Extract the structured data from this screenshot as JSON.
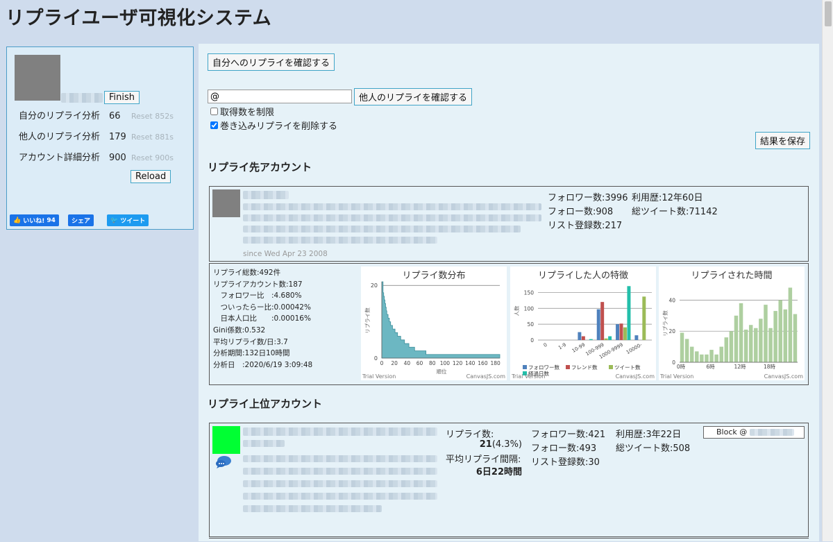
{
  "page": {
    "title": "リプライユーザ可視化システム"
  },
  "sidebar": {
    "finish_label": "Finish",
    "stats": [
      {
        "label": "自分のリプライ分析",
        "value": "66",
        "reset": "Reset 852s"
      },
      {
        "label": "他人のリプライ分析",
        "value": "179",
        "reset": "Reset 881s"
      },
      {
        "label": "アカウント詳細分析",
        "value": "900",
        "reset": "Reset 900s"
      }
    ],
    "reload_label": "Reload",
    "social": {
      "like_label": "いいね!",
      "like_count": "94",
      "share_label": "シェア",
      "tweet_label": "ツイート"
    }
  },
  "controls": {
    "check_own_button": "自分へのリプライを確認する",
    "at_input_value": "@",
    "check_others_button": "他人のリプライを確認する",
    "limit_checkbox_label": "取得数を制限",
    "limit_checked": false,
    "remove_checkbox_label": "巻き込みリプライを削除する",
    "remove_checked": true,
    "save_button": "結果を保存"
  },
  "reply_target": {
    "heading": "リプライ先アカウント",
    "since": "since Wed Apr 23 2008",
    "followers": "フォロワー数:3996",
    "tenure": "利用歴:12年60日",
    "following": "フォロー数:908",
    "total_tweets": "総ツイート数:71142",
    "listed": "リスト登録数:217"
  },
  "summary": {
    "lines": [
      "リプライ総数:492件",
      "リプライアカウント数:187",
      "　フォロワー比　:4.680%",
      "　ついったらー比:0.00042%",
      "　日本人口比　　:0.00016%",
      "Gini係数:0.532",
      "平均リプライ数/日:3.7",
      "分析期間:132日10時間",
      "分析日　:2020/6/19 3:09:48"
    ]
  },
  "charts": {
    "trial_label": "Trial Version",
    "brand_label": "CanvasJS.com"
  },
  "chart_data": [
    {
      "type": "area",
      "title": "リプライ数分布",
      "xlabel": "順位",
      "ylabel": "リプライ数",
      "xlim": [
        0,
        187
      ],
      "ylim": [
        0,
        21
      ],
      "x_ticks": [
        "0",
        "20",
        "40",
        "60",
        "80",
        "100",
        "120",
        "140",
        "160",
        "180"
      ],
      "y_ticks": [
        "0",
        "20"
      ],
      "values": [
        21,
        21,
        18,
        17,
        16,
        15,
        14,
        13,
        12,
        12,
        11,
        11,
        10,
        10,
        9,
        9,
        9,
        8,
        8,
        8,
        8,
        7,
        7,
        7,
        7,
        6,
        6,
        6,
        6,
        6,
        5,
        5,
        5,
        5,
        5,
        5,
        4,
        4,
        4,
        4,
        4,
        4,
        4,
        3,
        3,
        3,
        3,
        3,
        3,
        3,
        3,
        3,
        2,
        2,
        2,
        2,
        2,
        2,
        2,
        2,
        2,
        2,
        2,
        2,
        2,
        2,
        2,
        2,
        2,
        2,
        1
      ],
      "tail_value": 1,
      "grid": true
    },
    {
      "type": "bar",
      "title": "リプライした人の特徴",
      "ylabel": "人数",
      "categories": [
        "0",
        "1-9",
        "10-99",
        "100-999",
        "1000-9999",
        "10000-"
      ],
      "ylim": [
        0,
        175
      ],
      "y_ticks": [
        "0",
        "50",
        "100",
        "150"
      ],
      "series": [
        {
          "name": "フォロワー数",
          "color": "#4f81bc",
          "values": [
            0,
            0,
            25,
            97,
            50,
            15
          ]
        },
        {
          "name": "フレンド数",
          "color": "#c0504e",
          "values": [
            0,
            0,
            12,
            120,
            52,
            0
          ]
        },
        {
          "name": "ツイート数",
          "color": "#9bbb58",
          "values": [
            0,
            0,
            0,
            5,
            40,
            137
          ]
        },
        {
          "name": "経過日数",
          "color": "#23bfaa",
          "values": [
            0,
            0,
            3,
            12,
            170,
            0
          ]
        }
      ],
      "legend": "bottom"
    },
    {
      "type": "bar",
      "title": "リプライされた時間",
      "xlabel": "",
      "ylabel": "リプライ数",
      "categories": [
        "0時",
        "",
        "",
        "",
        "",
        "",
        "6時",
        "",
        "",
        "",
        "",
        "",
        "12時",
        "",
        "",
        "",
        "",
        "",
        "18時",
        "",
        "",
        "",
        "",
        ""
      ],
      "values": [
        19,
        15,
        10,
        7,
        5,
        5,
        8,
        5,
        10,
        16,
        20,
        30,
        38,
        21,
        24,
        22,
        28,
        37,
        22,
        33,
        40,
        34,
        48,
        31
      ],
      "color": "#aecfa0",
      "ylim": [
        0,
        50
      ],
      "y_ticks": [
        "0",
        "20",
        "40"
      ],
      "grid": true
    }
  ],
  "top_reply": {
    "heading": "リプライ上位アカウント",
    "reply_count_label": "リプライ数:",
    "reply_count_value": "21",
    "reply_share": "(4.3%)",
    "avg_interval_label": "平均リプライ間隔:",
    "avg_interval_value": "6日22時間",
    "followers": "フォロワー数:421",
    "tenure": "利用歴:3年22日",
    "following": "フォロー数:493",
    "total_tweets": "総ツイート数:508",
    "listed": "リスト登録数:30",
    "block_label": "Block @"
  },
  "colors": {
    "page_bg": "#cfdced",
    "panel_bg": "#e6f2f8",
    "accent_border": "#3fa4c7",
    "top_avatar": "#00ff33"
  }
}
